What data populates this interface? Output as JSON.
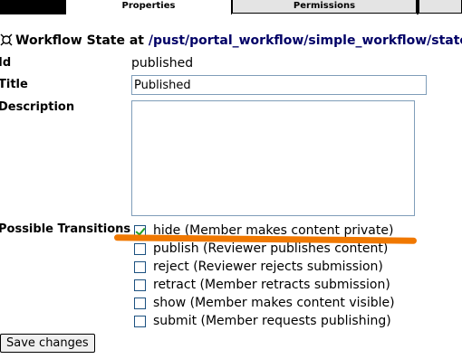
{
  "tabs": {
    "properties": "Properties",
    "permissions": "Permissions"
  },
  "heading": {
    "prefix": "Workflow State at",
    "path": "/pust/portal_workflow/simple_workflow/states/"
  },
  "form": {
    "id_label": "Id",
    "id_value": "published",
    "title_label": "Title",
    "title_value": "Published",
    "description_label": "Description",
    "description_value": "",
    "transitions_label": "Possible Transitions"
  },
  "transitions": [
    {
      "label": "hide (Member makes content private)",
      "checked": true
    },
    {
      "label": "publish (Reviewer publishes content)",
      "checked": false
    },
    {
      "label": "reject (Reviewer rejects submission)",
      "checked": false
    },
    {
      "label": "retract (Member retracts submission)",
      "checked": false
    },
    {
      "label": "show (Member makes content visible)",
      "checked": false
    },
    {
      "label": "submit (Member requests publishing)",
      "checked": false
    }
  ],
  "save_label": "Save changes",
  "colors": {
    "annotation": "#f07800",
    "check": "#21a121",
    "tab_inactive": "#e4e4e4"
  }
}
